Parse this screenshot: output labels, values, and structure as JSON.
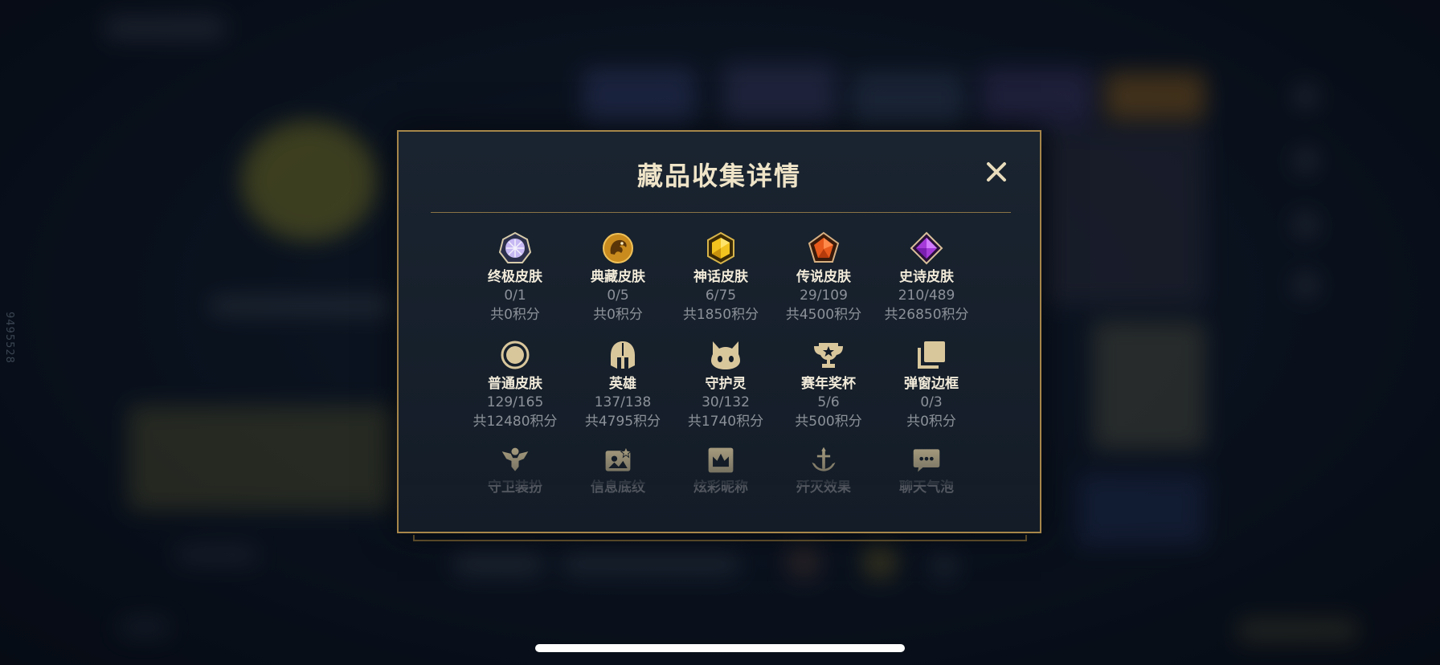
{
  "watermark": "9495528",
  "dialog": {
    "title": "藏品收集详情",
    "close_label": "×"
  },
  "collection": {
    "row1": [
      {
        "icon": "ultimate-skin-gem-icon",
        "label": "终极皮肤",
        "count": "0/1",
        "points": "共0积分",
        "color": "#b8a8e8"
      },
      {
        "icon": "prestige-skin-dragon-icon",
        "label": "典藏皮肤",
        "count": "0/5",
        "points": "共0积分",
        "color": "#d39a2c"
      },
      {
        "icon": "mythic-skin-gem-icon",
        "label": "神话皮肤",
        "count": "6/75",
        "points": "共1850积分",
        "color": "#e6b51c"
      },
      {
        "icon": "legendary-skin-gem-icon",
        "label": "传说皮肤",
        "count": "29/109",
        "points": "共4500积分",
        "color": "#e2561f"
      },
      {
        "icon": "epic-skin-gem-icon",
        "label": "史诗皮肤",
        "count": "210/489",
        "points": "共26850积分",
        "color": "#a93ad8"
      }
    ],
    "row2": [
      {
        "icon": "classic-skin-circle-icon",
        "label": "普通皮肤",
        "count": "129/165",
        "points": "共12480积分"
      },
      {
        "icon": "champion-helmet-icon",
        "label": "英雄",
        "count": "137/138",
        "points": "共4795积分"
      },
      {
        "icon": "little-legend-icon",
        "label": "守护灵",
        "count": "30/132",
        "points": "共1740积分"
      },
      {
        "icon": "trophy-icon",
        "label": "赛年奖杯",
        "count": "5/6",
        "points": "共500积分"
      },
      {
        "icon": "popup-frame-icon",
        "label": "弹窗边框",
        "count": "0/3",
        "points": "共0积分"
      }
    ],
    "row3": [
      {
        "icon": "ward-skin-icon",
        "label": "守卫装扮"
      },
      {
        "icon": "profile-background-icon",
        "label": "信息底纹"
      },
      {
        "icon": "nickname-crown-icon",
        "label": "炫彩昵称"
      },
      {
        "icon": "finisher-effect-icon",
        "label": "歼灭效果"
      },
      {
        "icon": "chat-bubble-icon",
        "label": "聊天气泡"
      }
    ]
  },
  "accent_color": "#a6864a",
  "icon_color": "#d9c79c"
}
